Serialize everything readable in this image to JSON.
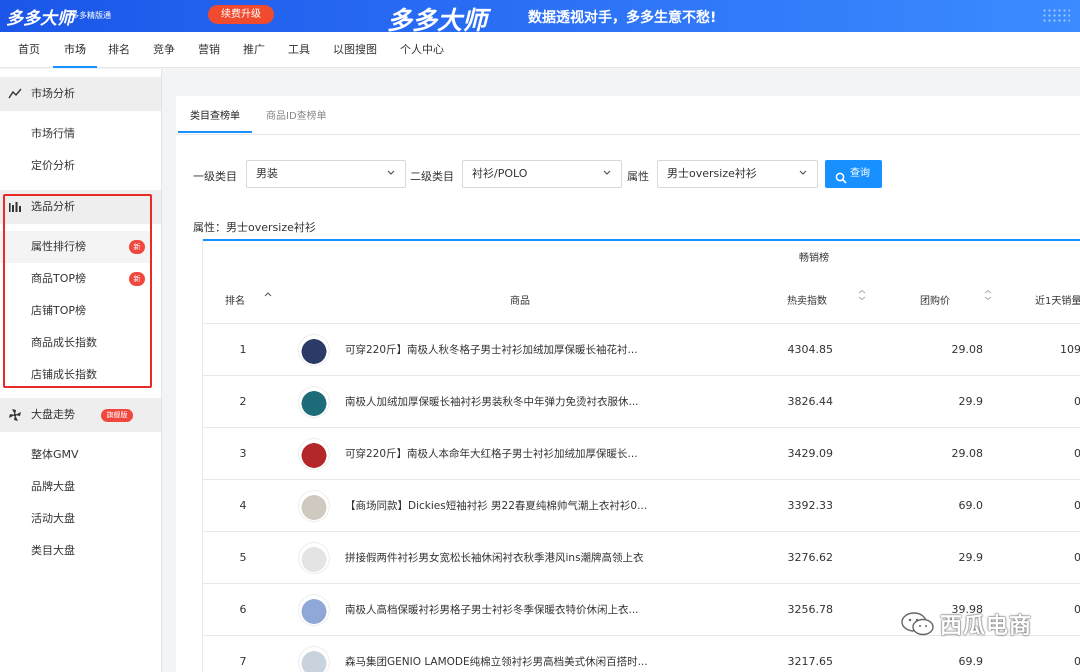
{
  "banner": {
    "logo": "多多大师",
    "logo_sub": "多多精版通",
    "upgrade_label": "续费升级",
    "slogan_big": "多多大师",
    "slogan": "数据透视对手，多多生意不愁!"
  },
  "nav": [
    "首页",
    "市场",
    "排名",
    "竞争",
    "营销",
    "推广",
    "工具",
    "以图搜图",
    "个人中心"
  ],
  "nav_active": "市场",
  "sidebar": {
    "market": {
      "title": "市场分析",
      "items": [
        "市场行情",
        "定价分析"
      ]
    },
    "selection": {
      "title": "选品分析",
      "items": [
        {
          "label": "属性排行榜",
          "badge": "新"
        },
        {
          "label": "商品TOP榜",
          "badge": "新"
        },
        {
          "label": "店铺TOP榜"
        },
        {
          "label": "商品成长指数"
        },
        {
          "label": "店铺成长指数"
        }
      ]
    },
    "trend": {
      "title": "大盘走势",
      "badge": "旗舰版",
      "items": [
        "整体GMV",
        "品牌大盘",
        "活动大盘",
        "类目大盘"
      ]
    }
  },
  "tabs": [
    "类目查榜单",
    "商品ID查榜单"
  ],
  "filters": {
    "level1_label": "一级类目",
    "level1_value": "男装",
    "level2_label": "二级类目",
    "level2_value": "衬衫/POLO",
    "attr_label": "属性",
    "attr_value": "男士oversize衬衫",
    "query_label": "查询"
  },
  "attr_line": "属性：男士oversize衬衫",
  "table": {
    "group_header": "畅销榜",
    "headers": {
      "rank": "排名",
      "product": "商品",
      "hot": "热卖指数",
      "price": "团购价",
      "sales": "近1天销量"
    },
    "rows": [
      {
        "rank": "1",
        "name": "可穿220斤】南极人秋冬格子男士衬衫加绒加厚保暖长袖花衬...",
        "hot": "4304.85",
        "price": "29.08",
        "sales": "109",
        "thumb": "#2b3a66"
      },
      {
        "rank": "2",
        "name": "南极人加绒加厚保暖长袖衬衫男装秋冬中年弹力免烫衬衣服休...",
        "hot": "3826.44",
        "price": "29.9",
        "sales": "0",
        "thumb": "#1e6b7a"
      },
      {
        "rank": "3",
        "name": "可穿220斤】南极人本命年大红格子男士衬衫加绒加厚保暖长...",
        "hot": "3429.09",
        "price": "29.08",
        "sales": "0",
        "thumb": "#b3262a"
      },
      {
        "rank": "4",
        "name": "【商场同款】Dickies短袖衬衫 男22春夏纯棉帅气潮上衣衬衫0...",
        "hot": "3392.33",
        "price": "69.0",
        "sales": "0",
        "thumb": "#cfc9c0"
      },
      {
        "rank": "5",
        "name": "拼接假两件衬衫男女宽松长袖休闲衬衣秋季港风ins潮牌高领上衣",
        "hot": "3276.62",
        "price": "29.9",
        "sales": "0",
        "thumb": "#e4e4e4"
      },
      {
        "rank": "6",
        "name": "南极人高档保暖衬衫男格子男士衬衫冬季保暖衣特价休闲上衣...",
        "hot": "3256.78",
        "price": "39.98",
        "sales": "0",
        "thumb": "#8fa8d8"
      },
      {
        "rank": "7",
        "name": "森马集团GENIO LAMODE纯棉立领衬衫男高档美式休闲百搭时...",
        "hot": "3217.65",
        "price": "69.9",
        "sales": "0",
        "thumb": "#c9d3de"
      }
    ]
  },
  "watermark": "西瓜电商",
  "colors": {
    "accent": "#1890ff",
    "badge_red": "#f0483e",
    "highlight_border": "#e82a2a",
    "banner_blue": "#1b56e8"
  }
}
